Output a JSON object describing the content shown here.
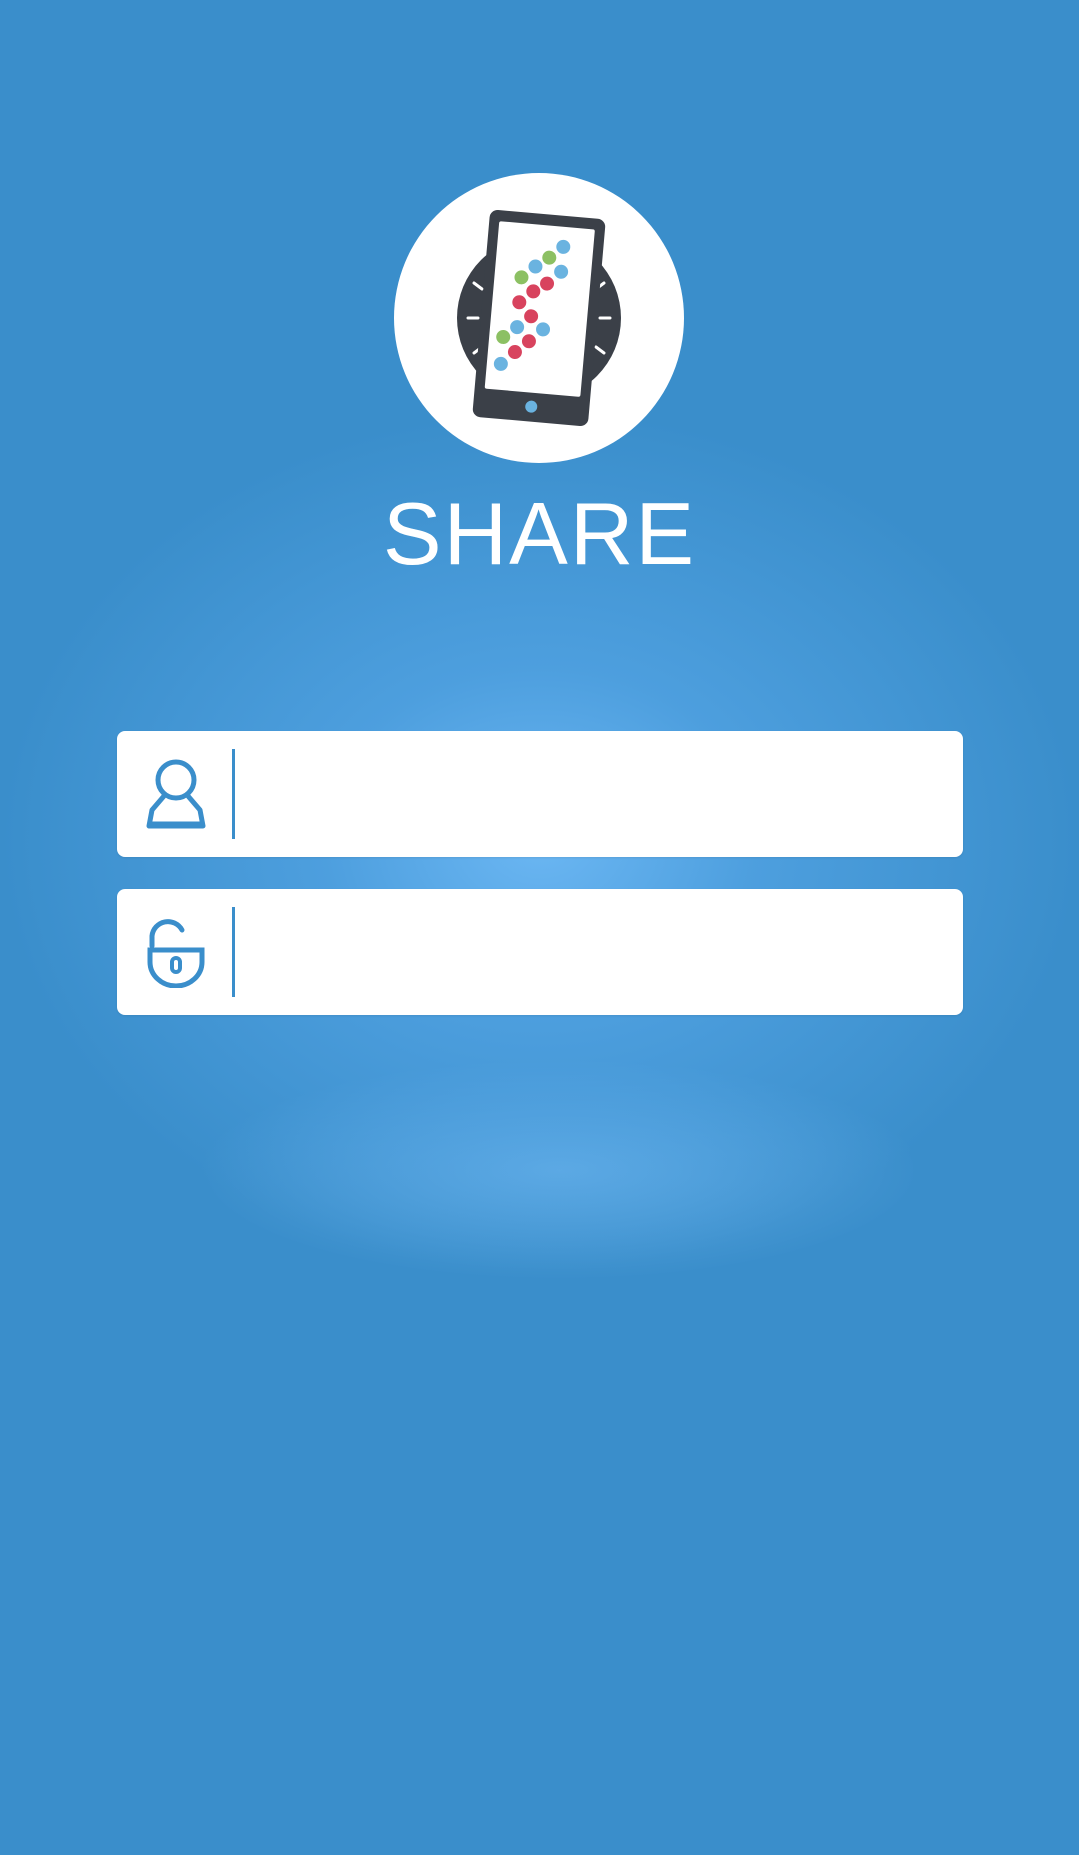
{
  "app": {
    "title": "SHARE",
    "logo_icon": "phone-with-colored-dots-icon"
  },
  "login": {
    "username": {
      "value": "",
      "placeholder": "",
      "icon": "user-icon"
    },
    "password": {
      "value": "",
      "placeholder": "",
      "icon": "unlock-icon"
    }
  },
  "colors": {
    "background": "#3a8ecb",
    "accent": "#3a8ecb",
    "logo_dark": "#3b4048",
    "dot_blue": "#6ab3e0",
    "dot_green": "#8cc063",
    "dot_red": "#d8435e"
  }
}
